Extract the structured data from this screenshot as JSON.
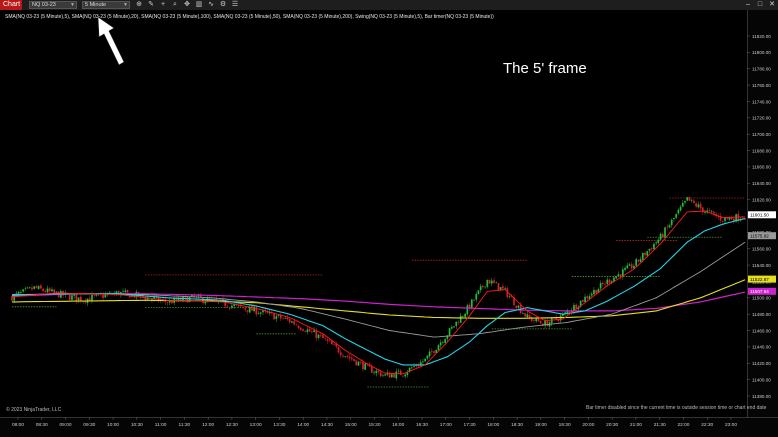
{
  "window": {
    "tab_label": "Chart"
  },
  "toolbar": {
    "instrument": "NQ 03-23",
    "interval": "5 Minute",
    "tools": [
      "zoom-icon",
      "draw-icon",
      "crosshair-icon",
      "search-icon",
      "nav-icon",
      "chart-style-icon",
      "indicator-icon",
      "strategy-icon",
      "properties-icon"
    ]
  },
  "indicators_line": "SMA(NQ 03-23 (5 Minute),5), SMA(NQ 03-23 (5 Minute),20), SMA(NQ 03-23 (5 Minute),100), SMA(NQ 03-23 (5 Minute),50), SMA(NQ 03-23 (5 Minute),200), Swing(NQ 03-23 (5 Minute),5), Bar timer(NQ 03-23 (5 Minute))",
  "annotation": "The 5' frame",
  "copyright": "© 2023 NinjaTrader, LLC",
  "bar_timer_status": "Bar timer disabled since the current time is outside session time or chart end date",
  "colors": {
    "bull": "#1fbf3a",
    "bear": "#d8202a",
    "sma5": "#ff1a1a",
    "sma20": "#27d4e8",
    "sma50": "#9a9a9a",
    "sma100": "#e6e01c",
    "sma200": "#cc22cc",
    "swing_high": "#c0201d",
    "swing_low": "#4f9a2a"
  },
  "chart_data": {
    "type": "candlestick",
    "title": "",
    "y_ticks": [
      "11820.00",
      "11800.00",
      "11780.00",
      "11760.00",
      "11740.00",
      "11720.00",
      "11700.00",
      "11680.00",
      "11660.00",
      "11640.00",
      "11620.00",
      "11600.00",
      "11580.00",
      "11560.00",
      "11540.00",
      "11520.00",
      "11500.00",
      "11480.00",
      "11460.00",
      "11440.00",
      "11420.00",
      "11400.00",
      "11380.00"
    ],
    "x_ticks": [
      "08:00",
      "08:30",
      "09:00",
      "09:30",
      "10:00",
      "10:30",
      "11:00",
      "11:30",
      "12:00",
      "12:30",
      "13:00",
      "13:30",
      "14:00",
      "14:30",
      "15:00",
      "15:30",
      "16:00",
      "16:30",
      "17:00",
      "17:30",
      "18:00",
      "18:30",
      "19:00",
      "19:30",
      "20:00",
      "20:30",
      "21:00",
      "21:30",
      "22:00",
      "22:30",
      "23:00"
    ],
    "ylim": [
      11370,
      11830
    ],
    "price_labels": [
      {
        "name": "last-price",
        "value": "11601.50",
        "bg": "#ffffff",
        "fg": "#000000"
      },
      {
        "name": "sma50-price",
        "value": "11575.92",
        "bg": "#9a9a9a",
        "fg": "#000000"
      },
      {
        "name": "sma100-price",
        "value": "11522.87",
        "bg": "#e6e01c",
        "fg": "#000000"
      },
      {
        "name": "sma200-price",
        "value": "11507.94",
        "bg": "#cc22cc",
        "fg": "#ffffff"
      }
    ],
    "anchors": {
      "close": [
        [
          0,
          11501
        ],
        [
          10,
          11512
        ],
        [
          20,
          11505
        ],
        [
          32,
          11498
        ],
        [
          48,
          11506
        ],
        [
          58,
          11502
        ],
        [
          70,
          11495
        ],
        [
          82,
          11500
        ],
        [
          95,
          11493
        ],
        [
          110,
          11484
        ],
        [
          125,
          11472
        ],
        [
          140,
          11450
        ],
        [
          150,
          11430
        ],
        [
          160,
          11414
        ],
        [
          168,
          11405
        ],
        [
          176,
          11408
        ],
        [
          186,
          11424
        ],
        [
          196,
          11456
        ],
        [
          206,
          11490
        ],
        [
          214,
          11522
        ],
        [
          222,
          11508
        ],
        [
          232,
          11476
        ],
        [
          240,
          11468
        ],
        [
          248,
          11478
        ],
        [
          258,
          11500
        ],
        [
          268,
          11520
        ],
        [
          280,
          11540
        ],
        [
          292,
          11574
        ],
        [
          304,
          11620
        ],
        [
          312,
          11606
        ],
        [
          320,
          11596
        ],
        [
          330,
          11600
        ]
      ],
      "sma5": [
        [
          0,
          11501
        ],
        [
          20,
          11506
        ],
        [
          48,
          11504
        ],
        [
          70,
          11497
        ],
        [
          95,
          11495
        ],
        [
          110,
          11487
        ],
        [
          125,
          11476
        ],
        [
          140,
          11456
        ],
        [
          150,
          11436
        ],
        [
          160,
          11419
        ],
        [
          168,
          11408
        ],
        [
          176,
          11407
        ],
        [
          186,
          11418
        ],
        [
          196,
          11446
        ],
        [
          206,
          11478
        ],
        [
          214,
          11508
        ],
        [
          222,
          11510
        ],
        [
          232,
          11484
        ],
        [
          240,
          11472
        ],
        [
          248,
          11474
        ],
        [
          258,
          11494
        ],
        [
          268,
          11515
        ],
        [
          280,
          11535
        ],
        [
          292,
          11566
        ],
        [
          304,
          11605
        ],
        [
          312,
          11606
        ],
        [
          320,
          11598
        ],
        [
          330,
          11599
        ]
      ],
      "sma20": [
        [
          0,
          11503
        ],
        [
          20,
          11505
        ],
        [
          48,
          11505
        ],
        [
          70,
          11500
        ],
        [
          95,
          11497
        ],
        [
          110,
          11490
        ],
        [
          125,
          11480
        ],
        [
          140,
          11466
        ],
        [
          150,
          11450
        ],
        [
          160,
          11436
        ],
        [
          168,
          11425
        ],
        [
          176,
          11418
        ],
        [
          186,
          11418
        ],
        [
          196,
          11428
        ],
        [
          206,
          11446
        ],
        [
          214,
          11466
        ],
        [
          222,
          11482
        ],
        [
          232,
          11488
        ],
        [
          240,
          11484
        ],
        [
          248,
          11480
        ],
        [
          258,
          11484
        ],
        [
          268,
          11496
        ],
        [
          280,
          11514
        ],
        [
          292,
          11536
        ],
        [
          304,
          11568
        ],
        [
          312,
          11582
        ],
        [
          320,
          11590
        ],
        [
          330,
          11597
        ]
      ],
      "sma50": [
        [
          0,
          11504
        ],
        [
          30,
          11505
        ],
        [
          60,
          11504
        ],
        [
          90,
          11500
        ],
        [
          110,
          11495
        ],
        [
          130,
          11487
        ],
        [
          150,
          11474
        ],
        [
          170,
          11460
        ],
        [
          190,
          11452
        ],
        [
          210,
          11456
        ],
        [
          230,
          11464
        ],
        [
          250,
          11470
        ],
        [
          270,
          11480
        ],
        [
          290,
          11500
        ],
        [
          310,
          11532
        ],
        [
          330,
          11568
        ]
      ],
      "sma100": [
        [
          0,
          11495
        ],
        [
          30,
          11496
        ],
        [
          60,
          11497
        ],
        [
          90,
          11496
        ],
        [
          110,
          11494
        ],
        [
          130,
          11489
        ],
        [
          150,
          11484
        ],
        [
          170,
          11479
        ],
        [
          190,
          11476
        ],
        [
          210,
          11475
        ],
        [
          230,
          11475
        ],
        [
          250,
          11476
        ],
        [
          270,
          11478
        ],
        [
          290,
          11484
        ],
        [
          310,
          11500
        ],
        [
          330,
          11522
        ]
      ],
      "sma200": [
        [
          0,
          11502
        ],
        [
          30,
          11505
        ],
        [
          60,
          11505
        ],
        [
          90,
          11503
        ],
        [
          110,
          11501
        ],
        [
          130,
          11499
        ],
        [
          150,
          11496
        ],
        [
          170,
          11492
        ],
        [
          190,
          11489
        ],
        [
          210,
          11487
        ],
        [
          230,
          11485
        ],
        [
          250,
          11484
        ],
        [
          270,
          11484
        ],
        [
          290,
          11487
        ],
        [
          310,
          11495
        ],
        [
          330,
          11507
        ]
      ]
    },
    "swing_levels": [
      {
        "kind": "high",
        "from": 60,
        "to": 140,
        "price": 11528
      },
      {
        "kind": "high",
        "from": 180,
        "to": 232,
        "price": 11546
      },
      {
        "kind": "high",
        "from": 272,
        "to": 300,
        "price": 11570
      },
      {
        "kind": "high",
        "from": 296,
        "to": 330,
        "price": 11622
      },
      {
        "kind": "low",
        "from": 0,
        "to": 20,
        "price": 11489
      },
      {
        "kind": "low",
        "from": 60,
        "to": 110,
        "price": 11488
      },
      {
        "kind": "low",
        "from": 110,
        "to": 128,
        "price": 11456
      },
      {
        "kind": "low",
        "from": 160,
        "to": 188,
        "price": 11391
      },
      {
        "kind": "low",
        "from": 216,
        "to": 252,
        "price": 11462
      },
      {
        "kind": "low",
        "from": 252,
        "to": 292,
        "price": 11526
      },
      {
        "kind": "low",
        "from": 286,
        "to": 320,
        "price": 11574
      }
    ]
  }
}
